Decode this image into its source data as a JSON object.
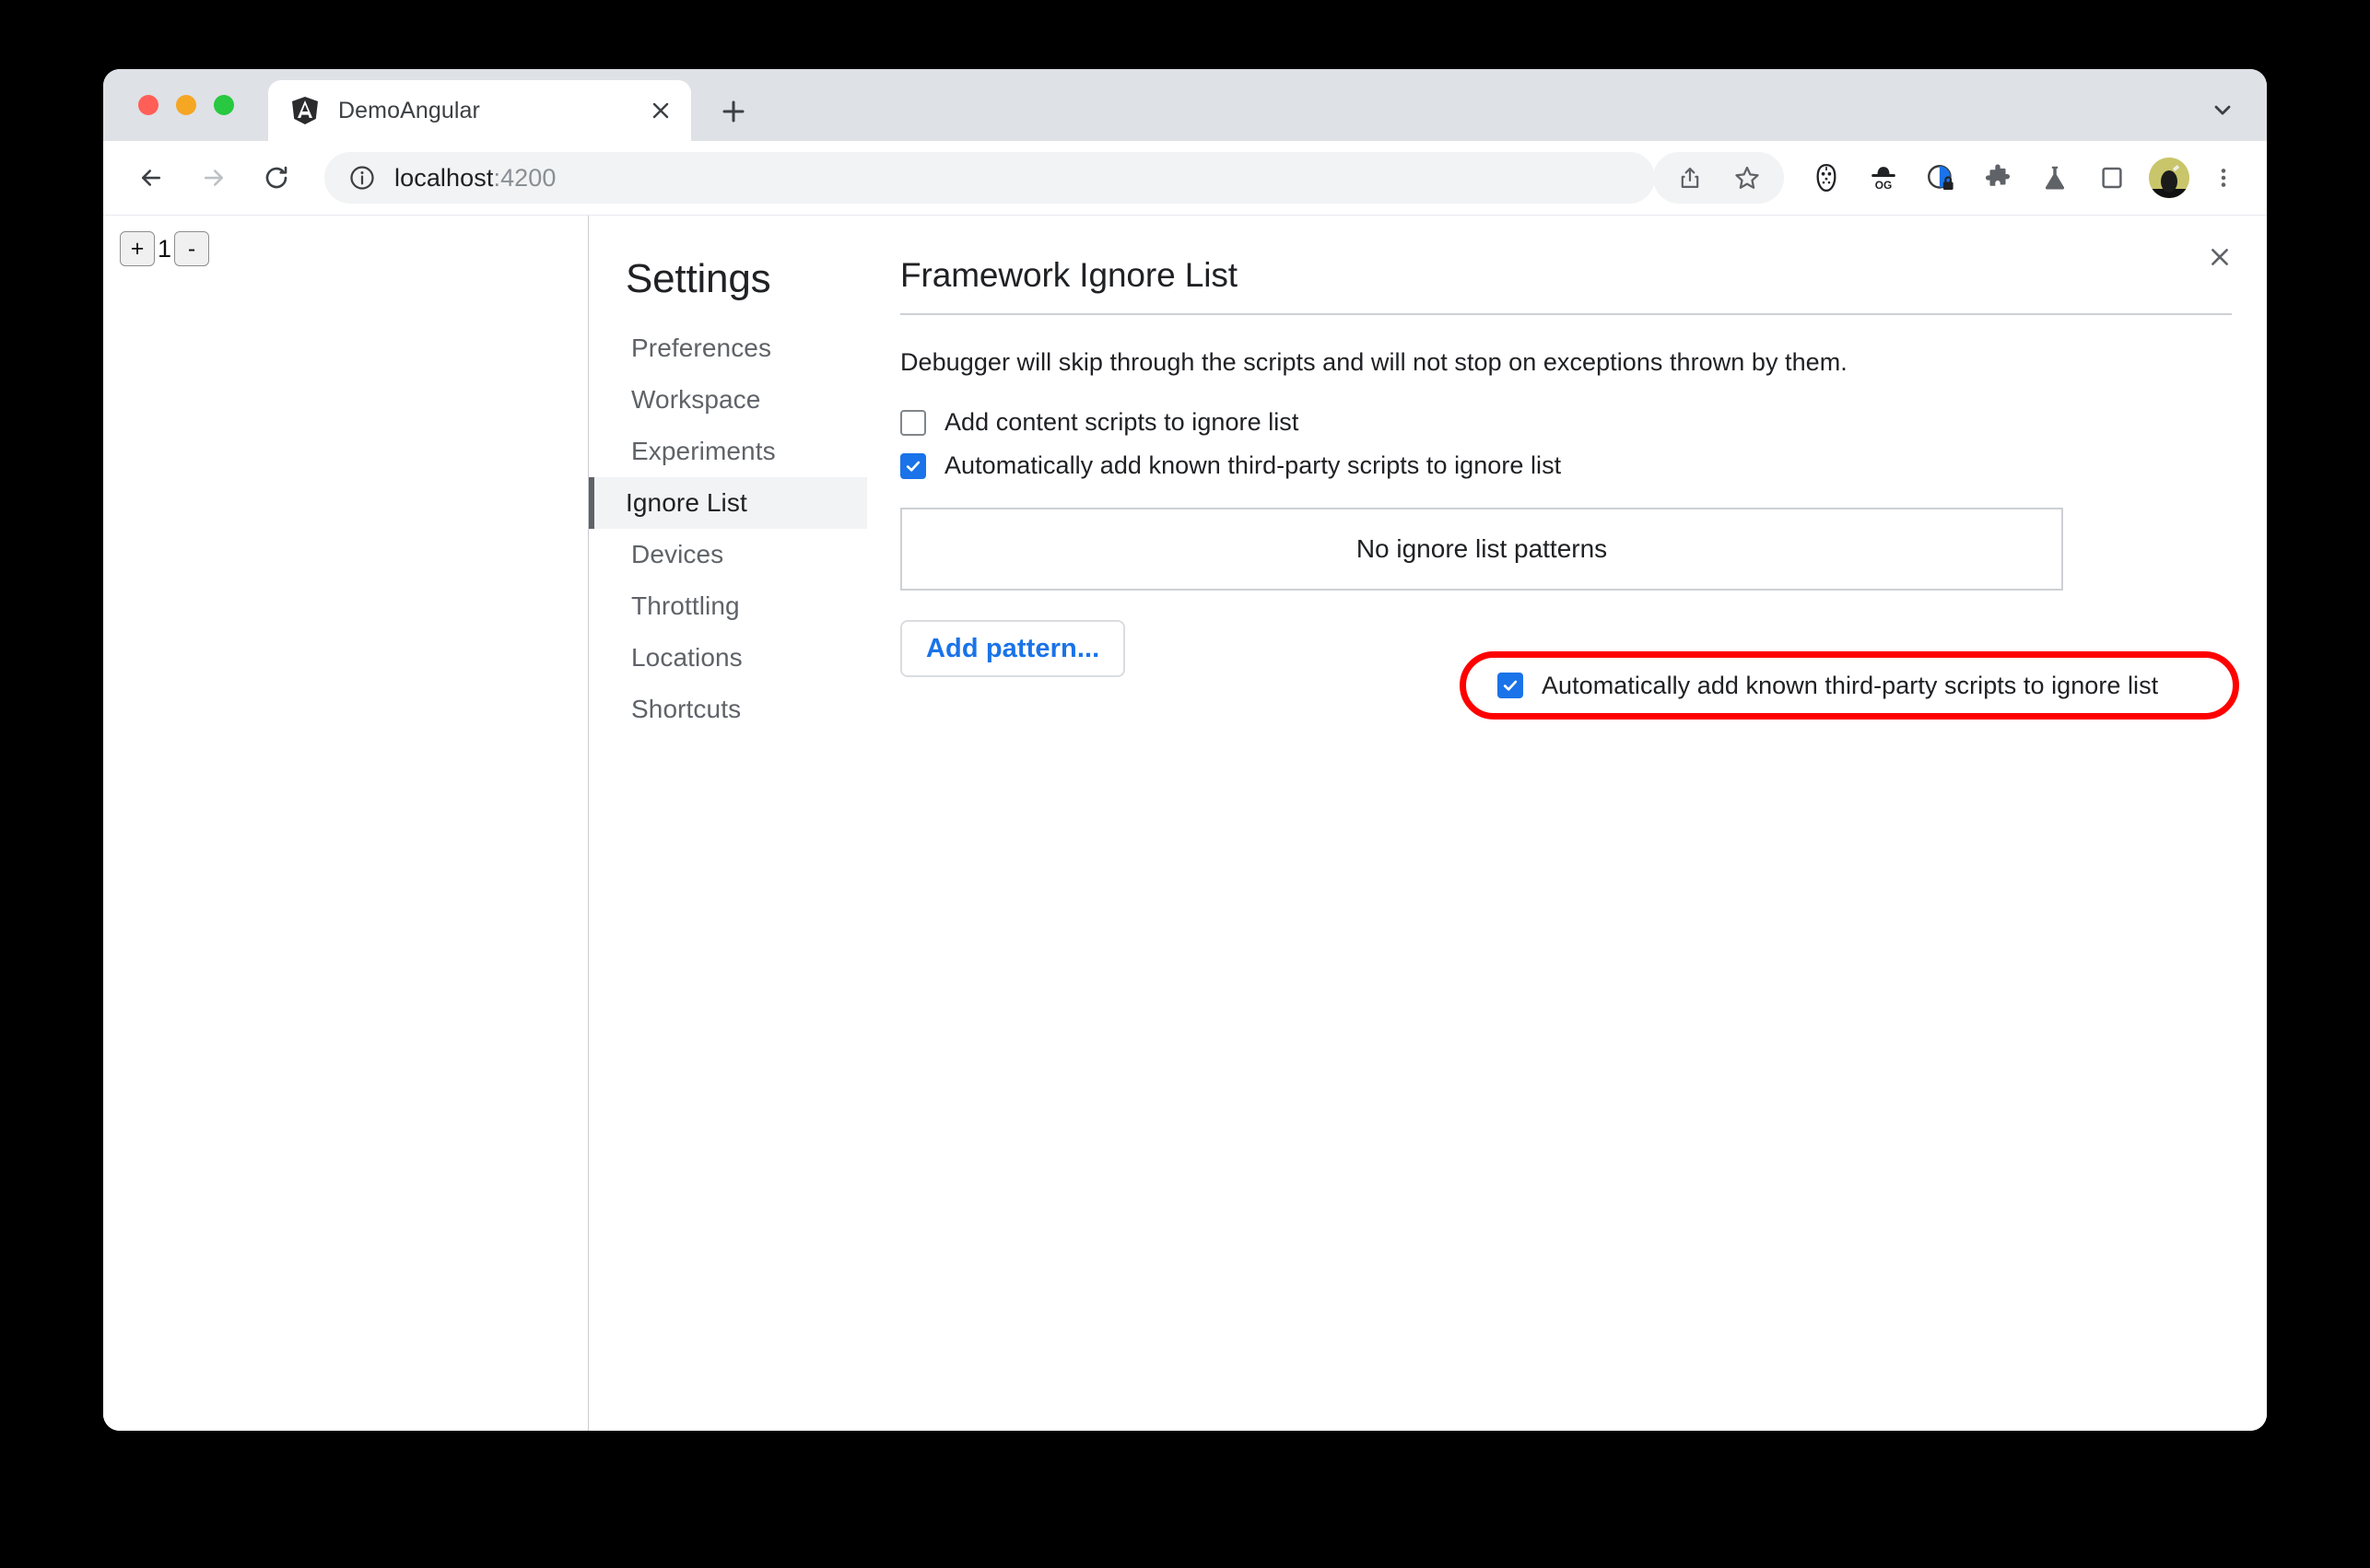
{
  "browser": {
    "tab": {
      "title": "DemoAngular",
      "favicon": "angular-logo-icon",
      "close_icon": "close-icon"
    },
    "new_tab_icon": "plus-icon",
    "tab_search_icon": "chevron-down-icon",
    "nav": {
      "back_icon": "back-arrow-icon",
      "forward_icon": "forward-arrow-icon",
      "reload_icon": "reload-icon"
    },
    "omnibox": {
      "site_info_icon": "info-circle-icon",
      "url_host": "localhost",
      "url_port": ":4200",
      "share_icon": "share-icon",
      "bookmark_icon": "star-icon"
    },
    "extensions": [
      {
        "icon": "hockey-mask-icon",
        "name": "hockey-mask-extension"
      },
      {
        "icon": "og-hat-icon",
        "name": "og-hat-extension"
      },
      {
        "icon": "privacy-lock-icon",
        "name": "privacy-badge-extension"
      },
      {
        "icon": "puzzle-icon",
        "name": "extensions-menu"
      },
      {
        "icon": "flask-icon",
        "name": "experiments-flask"
      },
      {
        "icon": "side-panel-icon",
        "name": "side-panel-toggle"
      }
    ],
    "avatar_icon": "profile-avatar",
    "menu_icon": "three-dot-menu-icon"
  },
  "page": {
    "stepper": {
      "increment_label": "+",
      "count": "1",
      "decrement_label": "-"
    }
  },
  "devtools": {
    "close_icon": "close-icon",
    "settings": {
      "heading": "Settings",
      "nav_items": [
        {
          "label": "Preferences",
          "selected": false
        },
        {
          "label": "Workspace",
          "selected": false
        },
        {
          "label": "Experiments",
          "selected": false
        },
        {
          "label": "Ignore List",
          "selected": true
        },
        {
          "label": "Devices",
          "selected": false
        },
        {
          "label": "Throttling",
          "selected": false
        },
        {
          "label": "Locations",
          "selected": false
        },
        {
          "label": "Shortcuts",
          "selected": false
        }
      ],
      "pane": {
        "title": "Framework Ignore List",
        "description": "Debugger will skip through the scripts and will not stop on exceptions thrown by them.",
        "checkboxes": [
          {
            "label": "Add content scripts to ignore list",
            "checked": false
          },
          {
            "label": "Automatically add known third-party scripts to ignore list",
            "checked": true,
            "highlighted": true
          }
        ],
        "patterns_empty_text": "No ignore list patterns",
        "add_pattern_label": "Add pattern..."
      }
    }
  },
  "annotation": {
    "color": "#ff0000",
    "shape": "rounded-rectangle",
    "target": "Automatically add known third-party scripts to ignore list"
  },
  "colors": {
    "accent_blue": "#1a73e8",
    "tab_strip": "#dee1e6",
    "selected_nav_bg": "#f1f3f4",
    "annotation_red": "#ff0000"
  }
}
